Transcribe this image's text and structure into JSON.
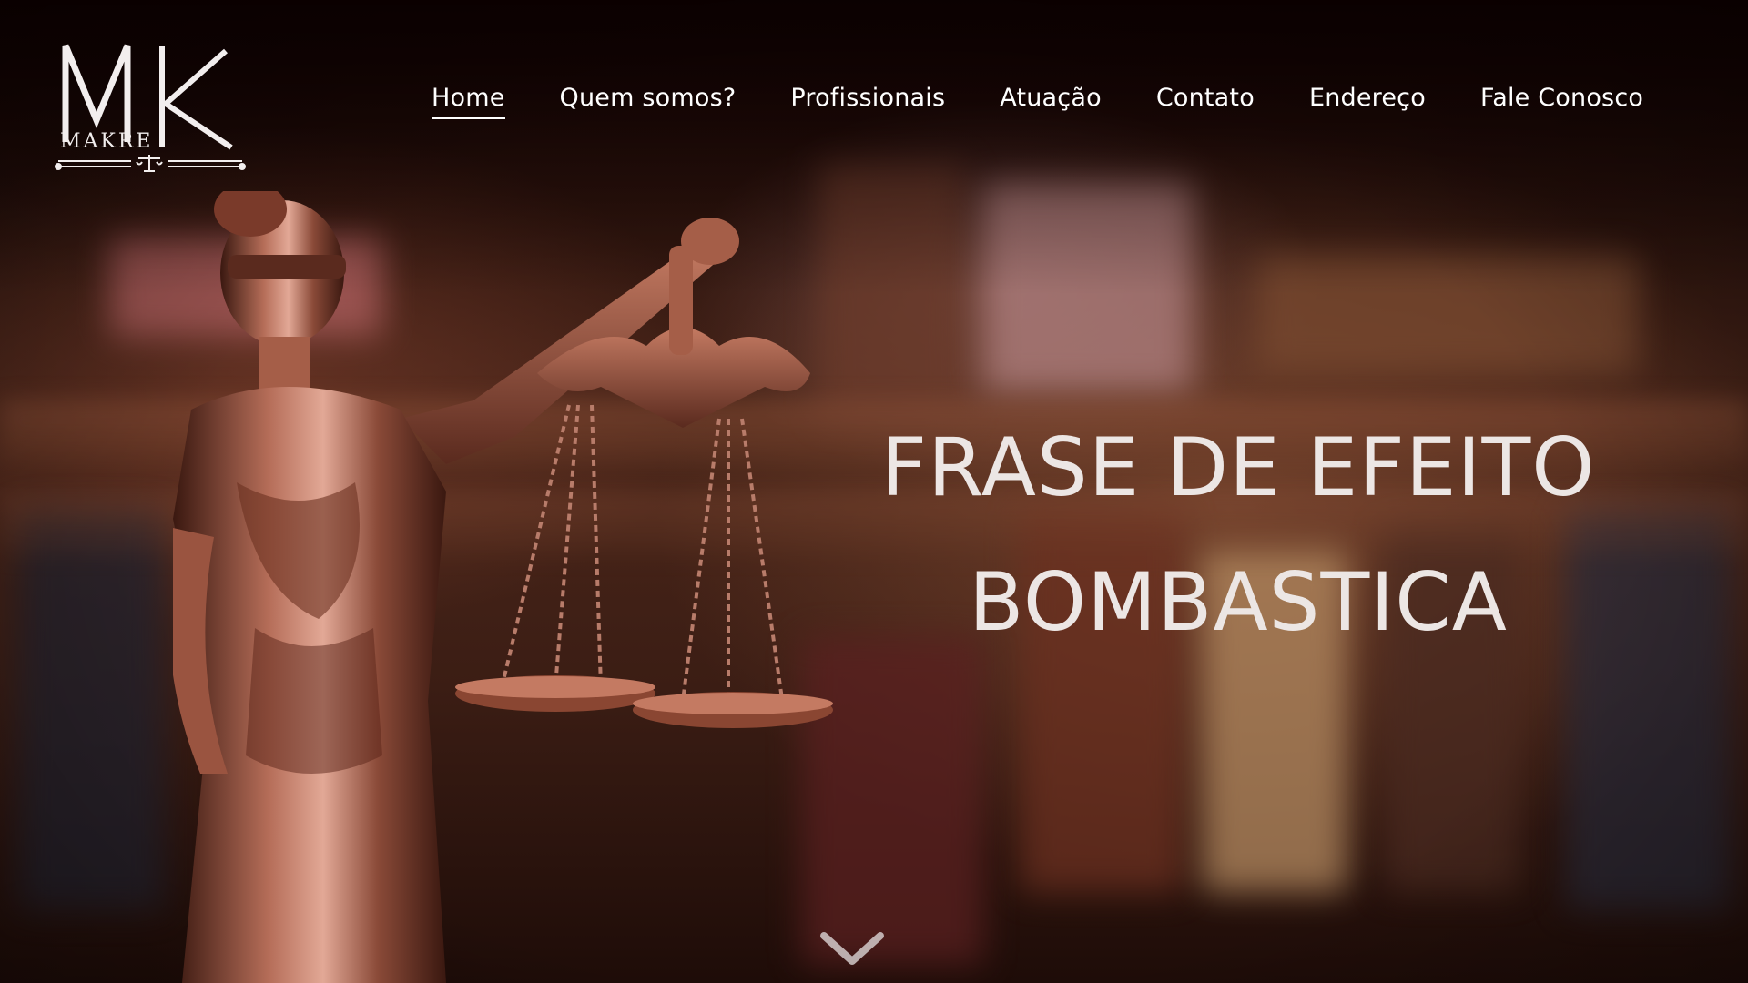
{
  "logo": {
    "monogram": "MK",
    "wordmark": "MAKRE",
    "icon": "scales-of-justice-icon"
  },
  "nav": {
    "items": [
      {
        "label": "Home",
        "active": true
      },
      {
        "label": "Quem somos?",
        "active": false
      },
      {
        "label": "Profissionais",
        "active": false
      },
      {
        "label": "Atuação",
        "active": false
      },
      {
        "label": "Contato",
        "active": false
      },
      {
        "label": "Endereço",
        "active": false
      },
      {
        "label": "Fale Conosco",
        "active": false
      }
    ]
  },
  "hero": {
    "line1": "FRASE DE EFEITO",
    "line2": "BOMBASTICA",
    "image": "lady-justice-statue",
    "scroll_icon": "chevron-down-icon"
  },
  "colors": {
    "text": "#ffffff",
    "headline": "#ece6e4",
    "bronze": "#8a4a38",
    "background": "#2a120c"
  }
}
